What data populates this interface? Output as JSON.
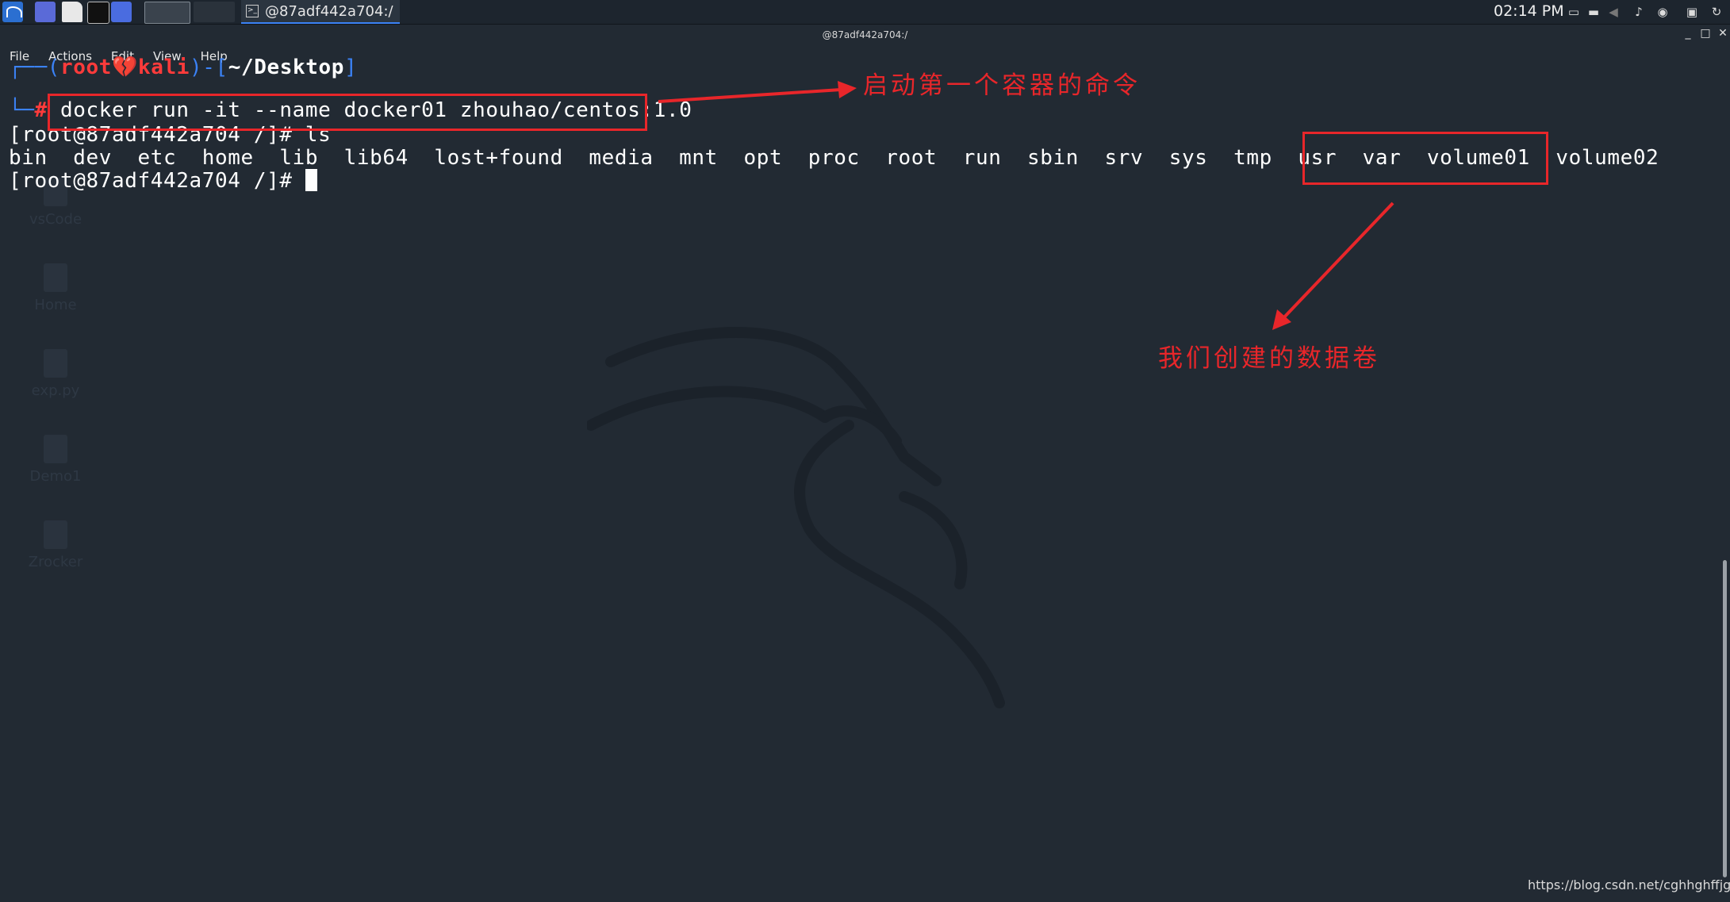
{
  "panel": {
    "task_title": "@87adf442a704:/",
    "task_icon": "terminal-icon",
    "clock": "02:14 PM"
  },
  "window": {
    "title": "@87adf442a704:/"
  },
  "menubar": {
    "items": [
      "File",
      "Actions",
      "Edit",
      "View",
      "Help"
    ]
  },
  "terminal": {
    "prompt_open": "┌──(",
    "prompt_user": "root💔kali",
    "prompt_mid": ")-[",
    "prompt_path": "~/Desktop",
    "prompt_close": "]",
    "prompt_corner": "└─",
    "prompt_hash": "#",
    "command": "docker run -it --name docker01 zhouhao/centos:1.0",
    "container_prompt_ls": "[root@87adf442a704 /]# ls",
    "ls_output": "bin  dev  etc  home  lib  lib64  lost+found  media  mnt  opt  proc  root  run  sbin  srv  sys  tmp  usr  var  ",
    "ls_volumes": "volume01  volume02",
    "container_prompt": "[root@87adf442a704 /]# "
  },
  "annotations": {
    "command_note": "启动第一个容器的命令",
    "volume_note": "我们创建的数据卷",
    "color": "#e8262a"
  },
  "desktop_icons": [
    "vsCode",
    "Home",
    "exp.py",
    "Demo1",
    "Zrocker"
  ],
  "watermark": "https://blog.csdn.net/cghhghffjgchg"
}
